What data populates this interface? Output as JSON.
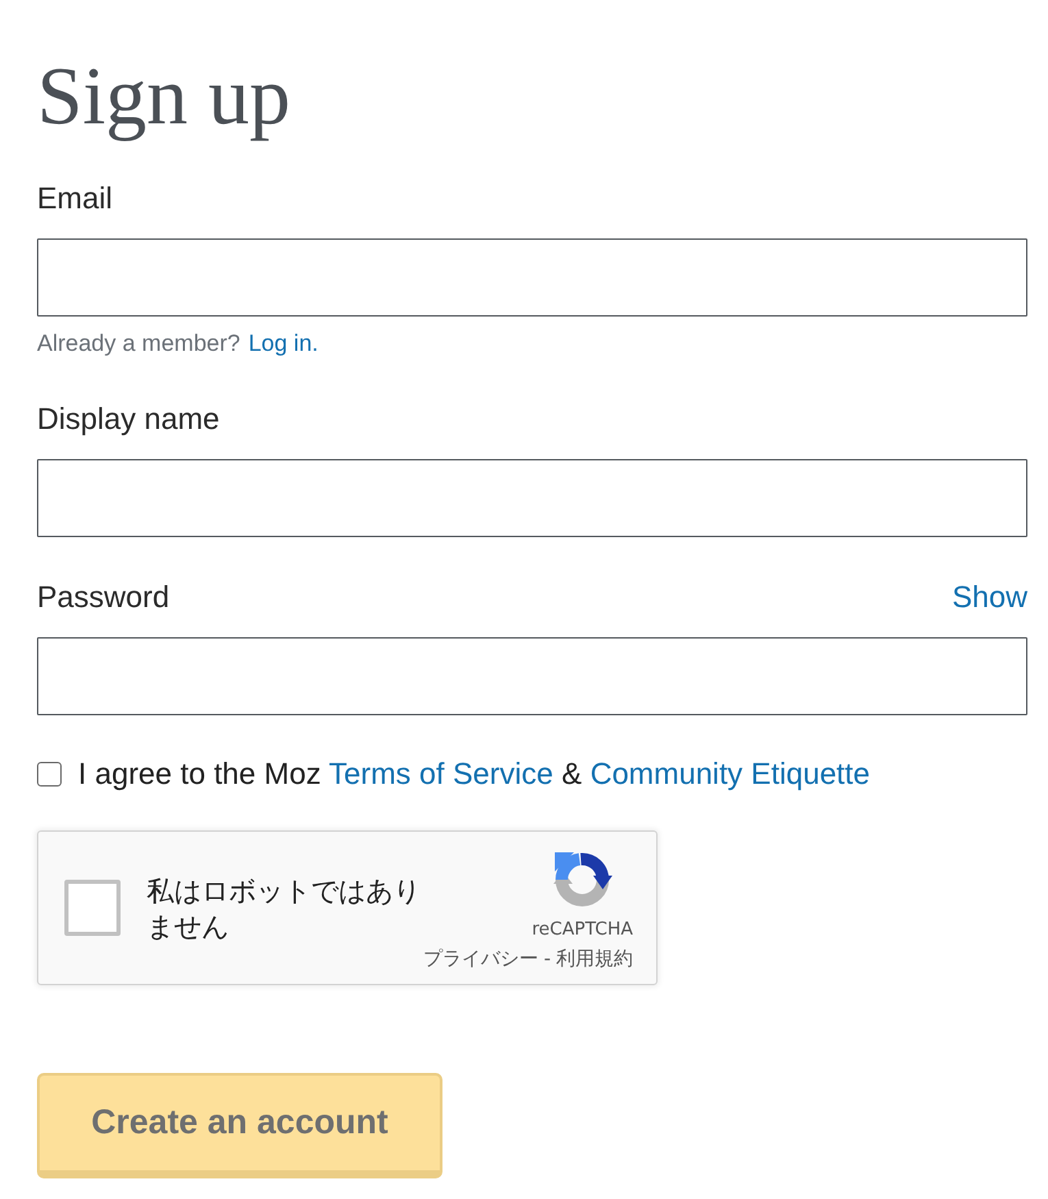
{
  "title": "Sign up",
  "fields": [
    {
      "label": "Email",
      "hint": {
        "text": "Already a member?",
        "link": "Log in."
      }
    },
    {
      "label": "Display name"
    },
    {
      "label": "Password",
      "action": "Show"
    }
  ],
  "agreement": {
    "checked": false,
    "parts": [
      {
        "kind": "text",
        "text": "I agree to the Moz"
      },
      {
        "kind": "link",
        "text": "Terms of Service"
      },
      {
        "kind": "text",
        "text": "&"
      },
      {
        "kind": "link",
        "text": "Community Etiquette"
      }
    ]
  },
  "captcha": {
    "checked": false,
    "label": "私はロボットではありません",
    "brand": "reCAPTCHA",
    "links": [
      "プライバシー",
      "利用規約"
    ],
    "separator": "-"
  },
  "submit": {
    "label": "Create an account",
    "disabled": true
  }
}
